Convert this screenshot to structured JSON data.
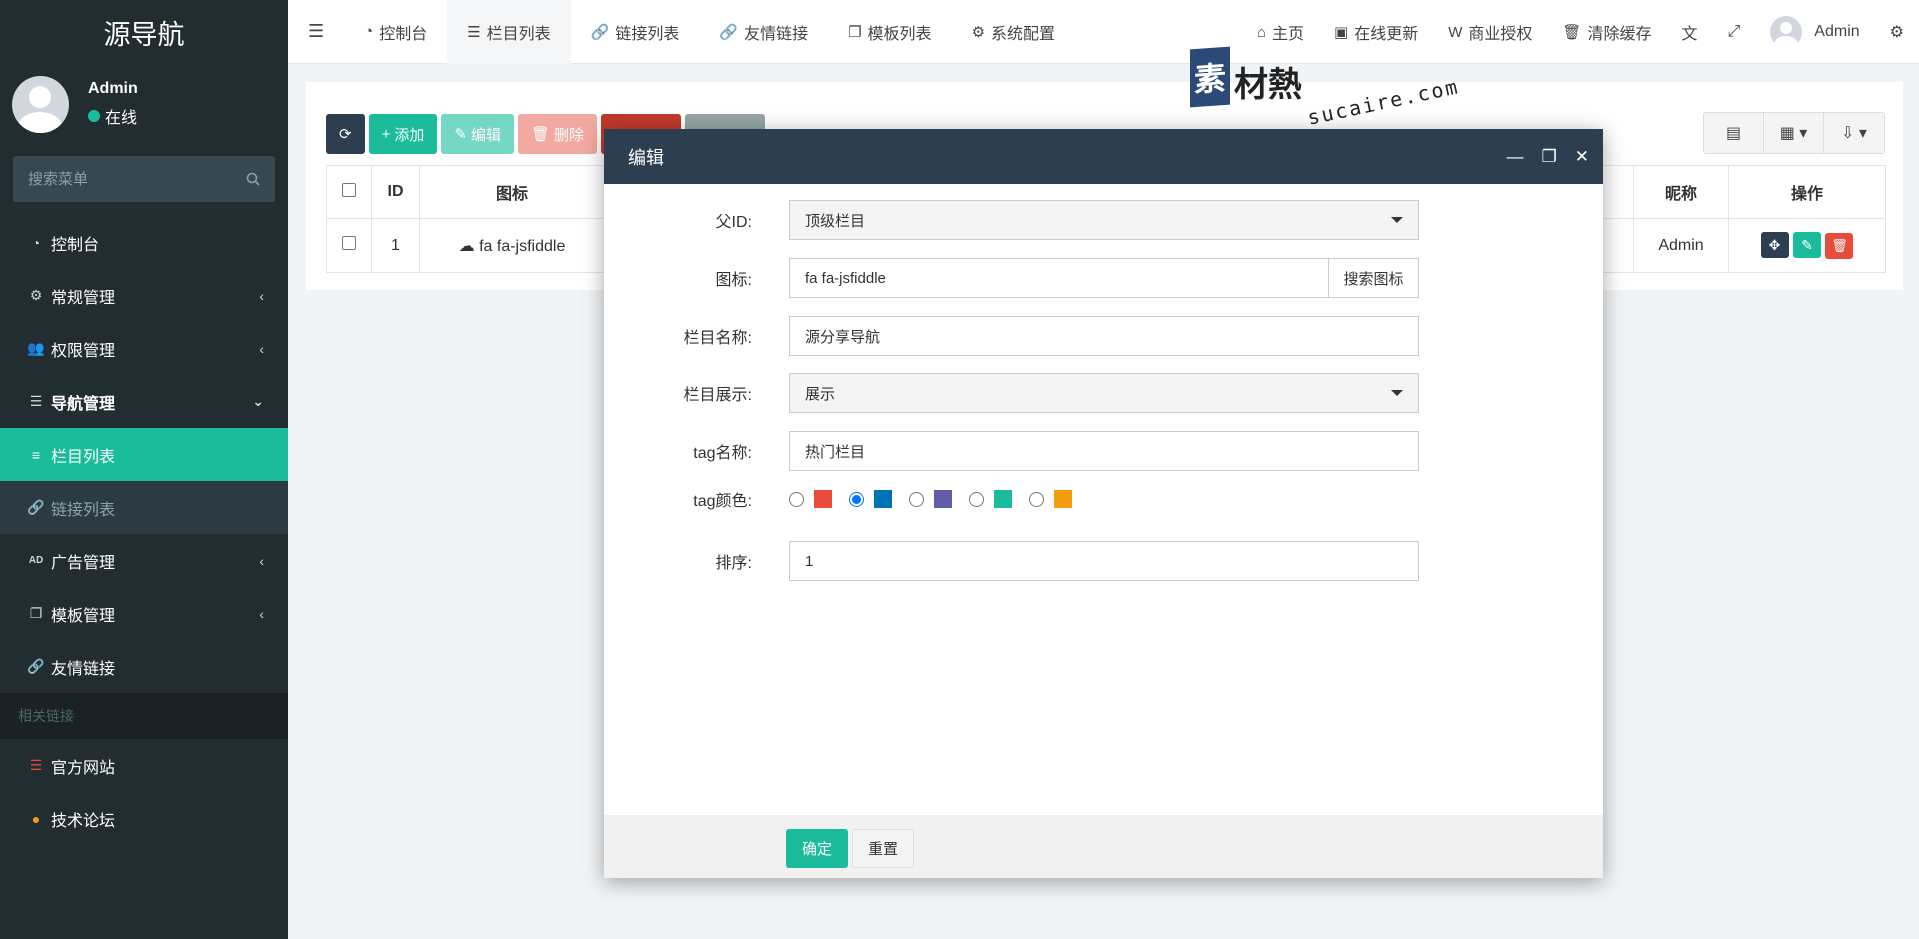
{
  "brand": "源导航",
  "user": {
    "name": "Admin",
    "status": "在线"
  },
  "sidebar_search": {
    "placeholder": "搜索菜单"
  },
  "sidebar": {
    "items": [
      {
        "label": "控制台",
        "icon": "dashboard-icon"
      },
      {
        "label": "常规管理",
        "icon": "cogs-icon"
      },
      {
        "label": "权限管理",
        "icon": "users-icon"
      },
      {
        "label": "导航管理",
        "icon": "list-icon"
      },
      {
        "label": "栏目列表",
        "icon": "bars-icon"
      },
      {
        "label": "链接列表",
        "icon": "link-icon"
      },
      {
        "label": "广告管理",
        "icon": "ad-icon"
      },
      {
        "label": "模板管理",
        "icon": "clone-icon"
      },
      {
        "label": "友情链接",
        "icon": "link-icon"
      }
    ],
    "header": "相关链接",
    "links": [
      {
        "label": "官方网站",
        "icon": "list-icon",
        "color": "#dd4b39"
      },
      {
        "label": "技术论坛",
        "icon": "comment-icon",
        "color": "#f39c12"
      }
    ]
  },
  "navbar": {
    "tabs": [
      {
        "label": "控制台"
      },
      {
        "label": "栏目列表"
      },
      {
        "label": "链接列表"
      },
      {
        "label": "友情链接"
      },
      {
        "label": "模板列表"
      },
      {
        "label": "系统配置"
      }
    ],
    "right": [
      {
        "label": "主页"
      },
      {
        "label": "在线更新"
      },
      {
        "label": "商业授权"
      },
      {
        "label": "清除缓存"
      }
    ],
    "user": "Admin"
  },
  "toolbar": {
    "add": "添加",
    "edit": "编辑",
    "delete": "删除"
  },
  "table": {
    "headers": [
      "ID",
      "图标",
      "昵称",
      "操作"
    ],
    "row": {
      "id": "1",
      "icon": "fa fa-jsfiddle",
      "nickname": "Admin"
    }
  },
  "modal": {
    "title": "编辑",
    "fields": {
      "parent_label": "父ID:",
      "parent_value": "顶级栏目",
      "icon_label": "图标:",
      "icon_value": "fa fa-jsfiddle",
      "icon_search": "搜索图标",
      "name_label": "栏目名称:",
      "name_value": "源分享导航",
      "show_label": "栏目展示:",
      "show_value": "展示",
      "tag_label": "tag名称:",
      "tag_value": "热门栏目",
      "color_label": "tag颜色:",
      "colors": [
        "#e74c3c",
        "#0073b7",
        "#605ca8",
        "#1abc9c",
        "#f39c12"
      ],
      "selected_color_index": 1,
      "sort_label": "排序:",
      "sort_value": "1"
    },
    "confirm": "确定",
    "reset": "重置"
  },
  "watermark": {
    "cn_logo": "素",
    "cn_text": "材熱",
    "en_text": "sucaire.com"
  }
}
